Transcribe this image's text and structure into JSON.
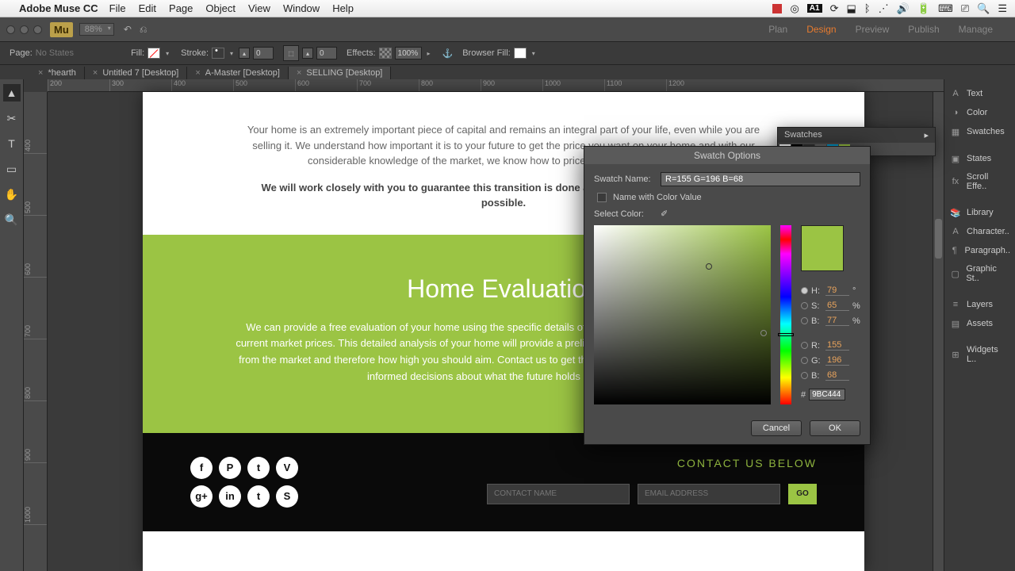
{
  "mac_menu": {
    "app_name": "Adobe Muse CC",
    "items": [
      "File",
      "Edit",
      "Page",
      "Object",
      "View",
      "Window",
      "Help"
    ],
    "cc_count": "1"
  },
  "app_top": {
    "zoom": "88%",
    "modes": [
      "Plan",
      "Design",
      "Preview",
      "Publish",
      "Manage"
    ],
    "active_mode": 1
  },
  "options": {
    "page_label": "Page:",
    "page_state": "No States",
    "fill_label": "Fill:",
    "stroke_label": "Stroke:",
    "stroke_val": "0",
    "corner_val": "0",
    "effects_label": "Effects:",
    "effects_val": "100%",
    "browser_fill_label": "Browser Fill:"
  },
  "tabs": [
    {
      "label": "*hearth",
      "close": true
    },
    {
      "label": "Untitled 7 [Desktop]",
      "close": true
    },
    {
      "label": "A-Master [Desktop]",
      "close": true
    },
    {
      "label": "SELLING [Desktop]",
      "close": true,
      "active": true
    }
  ],
  "ruler_h": [
    "200",
    "300",
    "400",
    "500",
    "600",
    "700",
    "800",
    "900",
    "1000",
    "1100",
    "1200"
  ],
  "ruler_v": [
    "400",
    "500",
    "600",
    "700",
    "800",
    "900",
    "1000"
  ],
  "page": {
    "sec1_text": "Your home is an extremely important piece of capital and remains an integral part of your life, even while you are selling it. We understand how important it is to your future to get the price you want on your home and with our considerable knowledge of the market, we know how to price it correctly, the first time.",
    "sec1_bold": "We will work closely with you to guarantee this transition is done as efficiently and successfully as possible.",
    "sec2_title": "Home Evaluation",
    "sec2_text": "We can provide a free evaluation of your home using the specific details of your listing to compare it with relevant current market prices. This detailed analysis of your home will provide a preliminary idea of how much you can expect from the market and therefore how high you should aim. Contact us to get this process started so that you can make informed decisions about what the future holds next for you.",
    "contact_title": "CONTACT US BELOW",
    "contact_name_ph": "CONTACT NAME",
    "contact_email_ph": "EMAIL ADDRESS",
    "go_label": "GO",
    "social": [
      "f",
      "P",
      "t",
      "V",
      "g+",
      "in",
      "t",
      "S"
    ]
  },
  "right_panels": [
    "Text",
    "Color",
    "Swatches",
    "States",
    "Scroll Effe..",
    "Library",
    "Character..",
    "Paragraph..",
    "Graphic St..",
    "Layers",
    "Assets",
    "Widgets L.."
  ],
  "swatches_panel_title": "Swatches",
  "dialog": {
    "title": "Swatch Options",
    "name_label": "Swatch Name:",
    "name_value": "R=155 G=196 B=68",
    "name_with_value": "Name with Color Value",
    "select_color": "Select Color:",
    "preview_hex": "#9BC444",
    "H": {
      "lbl": "H:",
      "v": "79",
      "u": "°"
    },
    "S": {
      "lbl": "S:",
      "v": "65",
      "u": "%"
    },
    "B": {
      "lbl": "B:",
      "v": "77",
      "u": "%"
    },
    "R": {
      "lbl": "R:",
      "v": "155",
      "u": ""
    },
    "G": {
      "lbl": "G:",
      "v": "196",
      "u": ""
    },
    "Bb": {
      "lbl": "B:",
      "v": "68",
      "u": ""
    },
    "hex_label": "#",
    "hex_value": "9BC444",
    "cancel": "Cancel",
    "ok": "OK"
  }
}
